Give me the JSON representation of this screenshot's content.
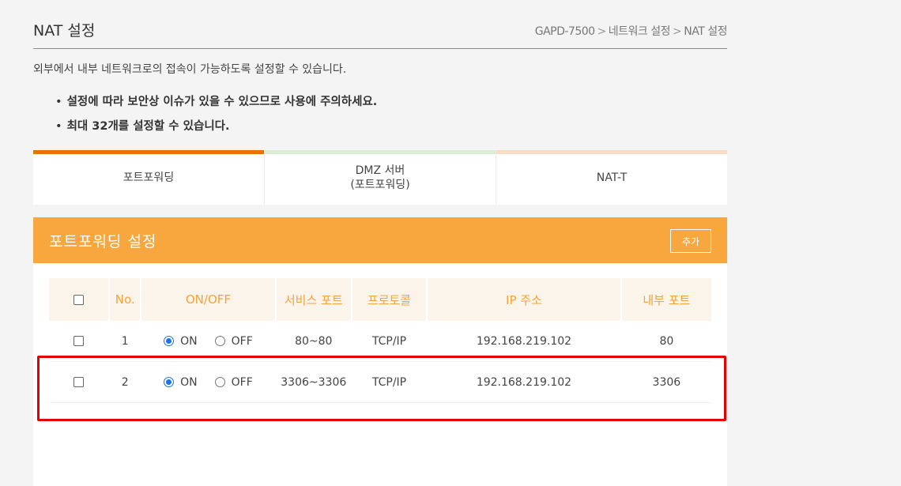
{
  "header": {
    "title": "NAT 설정",
    "breadcrumb": [
      "GAPD-7500",
      "네트워크 설정",
      "NAT 설정"
    ],
    "breadcrumb_sep": ">"
  },
  "description": "외부에서 내부 네트워크로의 접속이 가능하도록 설정할 수 있습니다.",
  "notes": {
    "bullet": "•",
    "items": [
      "설정에 따라 보안상 이슈가 있을 수 있으므로 사용에 주의하세요.",
      "최대 32개를 설정할 수 있습니다."
    ]
  },
  "tabs": [
    {
      "line1": "포트포워딩",
      "line2": ""
    },
    {
      "line1": "DMZ 서버",
      "line2": "(포트포워딩)"
    },
    {
      "line1": "NAT-T",
      "line2": ""
    }
  ],
  "panel": {
    "title": "포트포워딩 설정",
    "add_label": "추가"
  },
  "table": {
    "headers": {
      "no": "No.",
      "onoff": "ON/OFF",
      "service_port": "서비스 포트",
      "protocol": "프로토콜",
      "ip": "IP 주소",
      "internal_port": "내부 포트"
    },
    "rows": [
      {
        "no": "1",
        "on_label": "ON",
        "off_label": "OFF",
        "state": "ON",
        "service_port": "80~80",
        "protocol": "TCP/IP",
        "ip": "192.168.219.102",
        "internal_port": "80"
      },
      {
        "no": "2",
        "on_label": "ON",
        "off_label": "OFF",
        "state": "ON",
        "service_port": "3306~3306",
        "protocol": "TCP/IP",
        "ip": "192.168.219.102",
        "internal_port": "3306"
      }
    ]
  },
  "colors": {
    "accent": "#f8a73e",
    "active_tab": "#e57300",
    "highlight": "#e60000",
    "radio": "#1a73e8"
  }
}
